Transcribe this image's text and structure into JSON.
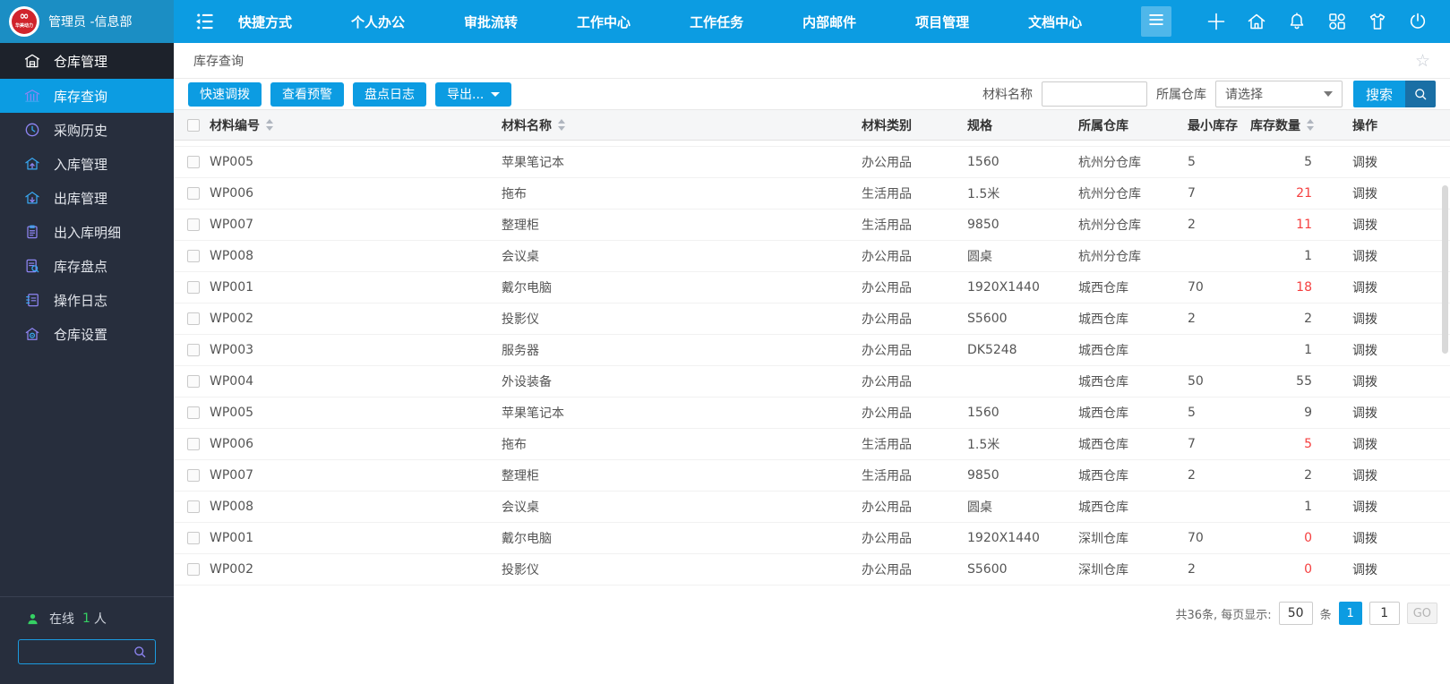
{
  "colors": {
    "accent": "#0c9ce2",
    "accent_dark": "#1a6fa5",
    "topbar_left": "#1b8ec4",
    "sidebar_bg": "#272e3d",
    "danger": "#f53f3f",
    "online_green": "#35d063"
  },
  "topbar": {
    "logo_text": "∞",
    "logo_sub": "华美动力",
    "user": "管理员 -信息部",
    "nav": [
      {
        "label": "快捷方式"
      },
      {
        "label": "个人办公"
      },
      {
        "label": "审批流转"
      },
      {
        "label": "工作中心"
      },
      {
        "label": "工作任务"
      },
      {
        "label": "内部邮件"
      },
      {
        "label": "项目管理"
      },
      {
        "label": "文档中心"
      }
    ],
    "right_icons": [
      "plus-icon",
      "home-icon",
      "bell-icon",
      "apps-icon",
      "theme-icon",
      "power-icon"
    ]
  },
  "sidebar": {
    "section": {
      "label": "仓库管理",
      "icon": "warehouse-icon",
      "name": "warehouse-management"
    },
    "items": [
      {
        "label": "库存查询",
        "icon": "inventory-query-icon",
        "name": "inventory-query",
        "active": true
      },
      {
        "label": "采购历史",
        "icon": "purchase-history-icon",
        "name": "purchase-history",
        "active": false
      },
      {
        "label": "入库管理",
        "icon": "inbound-icon",
        "name": "inbound-management",
        "active": false
      },
      {
        "label": "出库管理",
        "icon": "outbound-icon",
        "name": "outbound-management",
        "active": false
      },
      {
        "label": "出入库明细",
        "icon": "detail-icon",
        "name": "inout-detail",
        "active": false
      },
      {
        "label": "库存盘点",
        "icon": "stocktake-icon",
        "name": "stocktake",
        "active": false
      },
      {
        "label": "操作日志",
        "icon": "log-icon",
        "name": "operation-log",
        "active": false
      },
      {
        "label": "仓库设置",
        "icon": "settings-icon",
        "name": "warehouse-settings",
        "active": false
      }
    ],
    "online": {
      "label": "在线",
      "count": "1",
      "suffix": "人"
    },
    "search_value": ""
  },
  "breadcrumb": {
    "title": "库存查询",
    "star_icon": "☆"
  },
  "toolbar": {
    "buttons": [
      {
        "label": "快速调拨",
        "name": "quick-transfer-button",
        "dropdown": false
      },
      {
        "label": "查看预警",
        "name": "view-alerts-button",
        "dropdown": false
      },
      {
        "label": "盘点日志",
        "name": "stocktake-log-button",
        "dropdown": false
      },
      {
        "label": "导出...",
        "name": "export-button",
        "dropdown": true
      }
    ],
    "filters": {
      "name_label": "材料名称",
      "name_value": "",
      "warehouse_label": "所属仓库",
      "warehouse_value": "请选择",
      "search_label": "搜索"
    }
  },
  "table": {
    "columns": [
      {
        "label": "",
        "type": "check"
      },
      {
        "label": "材料编号",
        "sortable": true
      },
      {
        "label": "材料名称",
        "sortable": true
      },
      {
        "label": "材料类别",
        "sortable": false
      },
      {
        "label": "规格",
        "sortable": false
      },
      {
        "label": "所属仓库",
        "sortable": false
      },
      {
        "label": "最小库存",
        "sortable": false
      },
      {
        "label": "库存数量",
        "sortable": true
      },
      {
        "label": "操作",
        "sortable": false
      }
    ],
    "action_label": "调拨",
    "rows": [
      {
        "code": "WP005",
        "name": "苹果笔记本",
        "category": "办公用品",
        "spec": "1560",
        "warehouse": "杭州分仓库",
        "min": "5",
        "qty": "5",
        "low": false
      },
      {
        "code": "WP006",
        "name": "拖布",
        "category": "生活用品",
        "spec": "1.5米",
        "warehouse": "杭州分仓库",
        "min": "7",
        "qty": "21",
        "low": true
      },
      {
        "code": "WP007",
        "name": "整理柜",
        "category": "生活用品",
        "spec": "9850",
        "warehouse": "杭州分仓库",
        "min": "2",
        "qty": "11",
        "low": true
      },
      {
        "code": "WP008",
        "name": "会议桌",
        "category": "办公用品",
        "spec": "圆桌",
        "warehouse": "杭州分仓库",
        "min": "",
        "qty": "1",
        "low": false
      },
      {
        "code": "WP001",
        "name": "戴尔电脑",
        "category": "办公用品",
        "spec": "1920X1440",
        "warehouse": "城西仓库",
        "min": "70",
        "qty": "18",
        "low": true
      },
      {
        "code": "WP002",
        "name": "投影仪",
        "category": "办公用品",
        "spec": "S5600",
        "warehouse": "城西仓库",
        "min": "2",
        "qty": "2",
        "low": false
      },
      {
        "code": "WP003",
        "name": "服务器",
        "category": "办公用品",
        "spec": "DK5248",
        "warehouse": "城西仓库",
        "min": "",
        "qty": "1",
        "low": false
      },
      {
        "code": "WP004",
        "name": "外设装备",
        "category": "办公用品",
        "spec": "",
        "warehouse": "城西仓库",
        "min": "50",
        "qty": "55",
        "low": false
      },
      {
        "code": "WP005",
        "name": "苹果笔记本",
        "category": "办公用品",
        "spec": "1560",
        "warehouse": "城西仓库",
        "min": "5",
        "qty": "9",
        "low": false
      },
      {
        "code": "WP006",
        "name": "拖布",
        "category": "生活用品",
        "spec": "1.5米",
        "warehouse": "城西仓库",
        "min": "7",
        "qty": "5",
        "low": true
      },
      {
        "code": "WP007",
        "name": "整理柜",
        "category": "生活用品",
        "spec": "9850",
        "warehouse": "城西仓库",
        "min": "2",
        "qty": "2",
        "low": false
      },
      {
        "code": "WP008",
        "name": "会议桌",
        "category": "办公用品",
        "spec": "圆桌",
        "warehouse": "城西仓库",
        "min": "",
        "qty": "1",
        "low": false
      },
      {
        "code": "WP001",
        "name": "戴尔电脑",
        "category": "办公用品",
        "spec": "1920X1440",
        "warehouse": "深圳仓库",
        "min": "70",
        "qty": "0",
        "low": true
      },
      {
        "code": "WP002",
        "name": "投影仪",
        "category": "办公用品",
        "spec": "S5600",
        "warehouse": "深圳仓库",
        "min": "2",
        "qty": "0",
        "low": true
      }
    ]
  },
  "pagination": {
    "total_text": "共36条, 每页显示:",
    "page_size": "50",
    "unit": "条",
    "current_page": "1",
    "page_input": "1",
    "go_label": "GO"
  }
}
